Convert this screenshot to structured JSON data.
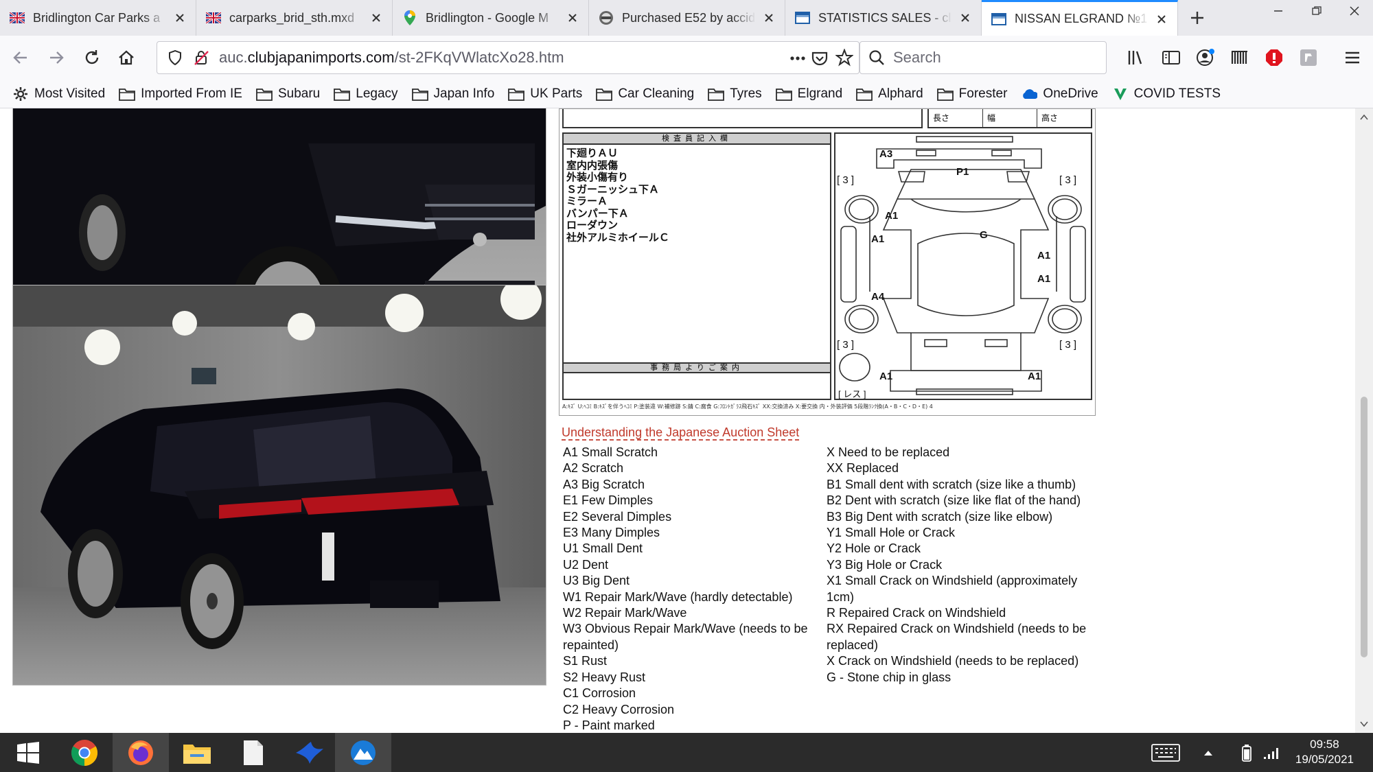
{
  "tabs": [
    {
      "title": "Bridlington Car Parks a",
      "icon": "union-jack-icon",
      "active": false
    },
    {
      "title": "carparks_brid_sth.mxd",
      "icon": "union-jack-icon",
      "active": false
    },
    {
      "title": "Bridlington - Google M",
      "icon": "maps-pin-icon",
      "active": false
    },
    {
      "title": "Purchased E52 by accid",
      "icon": "forum-icon",
      "active": false
    },
    {
      "title": "STATISTICS SALES - clu",
      "icon": "site-blue-icon",
      "active": false
    },
    {
      "title": "NISSAN ELGRAND №1",
      "icon": "site-blue-icon",
      "active": true
    }
  ],
  "address_bar": {
    "prefix": "auc.",
    "domain": "clubjapanimports.com",
    "path": "/st-2FKqVWlatcXo28.htm"
  },
  "search": {
    "placeholder": "Search"
  },
  "bookmarks": [
    {
      "label": "Most Visited",
      "icon": "gear-icon"
    },
    {
      "label": "Imported From IE",
      "icon": "folder-icon"
    },
    {
      "label": "Subaru",
      "icon": "folder-icon"
    },
    {
      "label": "Legacy",
      "icon": "folder-icon"
    },
    {
      "label": "Japan Info",
      "icon": "folder-icon"
    },
    {
      "label": "UK Parts",
      "icon": "folder-icon"
    },
    {
      "label": "Car Cleaning",
      "icon": "folder-icon"
    },
    {
      "label": "Tyres",
      "icon": "folder-icon"
    },
    {
      "label": "Elgrand",
      "icon": "folder-icon"
    },
    {
      "label": "Alphard",
      "icon": "folder-icon"
    },
    {
      "label": "Forester",
      "icon": "folder-icon"
    },
    {
      "label": "OneDrive",
      "icon": "cloud-icon"
    },
    {
      "label": "COVID TESTS",
      "icon": "v-icon"
    }
  ],
  "sheet": {
    "dims": [
      "長さ",
      "幅",
      "高さ"
    ],
    "inspector_header": "検査員記入欄",
    "inspector_notes": [
      "下廻りＡＵ",
      "室内内張傷",
      "外装小傷有り",
      "Ｓガーニッシュ下Ａ",
      "ミラーＡ",
      "バンパー下Ａ",
      "ローダウン",
      "社外アルミホイールＣ"
    ],
    "office_header": "事務局よりご案内",
    "footer": "A:ｷｽﾞ U:ﾍｺﾐ B:ｷｽﾞを伴うﾍｺﾐ P:塗装違 W:補修跡 S:錆 C:腐食 G:ﾌﾛﾝﾄｶﾞﾗｽ飛石ｷｽﾞ XX:交換済み X:要交換 内・外装評価 5段階ﾗﾝｸ換(A・B・C・D・E) 4",
    "diagram_labels": {
      "a3": "A3",
      "p1": "P1",
      "g": "G",
      "a1_fl": "A1",
      "a1_ml": "A1",
      "a1_mr": "A1",
      "a1_rr": "A1",
      "a4": "A4",
      "a1_bl": "A1",
      "a1_br": "A1",
      "n_tl": "[ 3 ]",
      "n_tr": "[ 3 ]",
      "n_bl": "[ 3 ]",
      "n_br": "[ 3 ]",
      "spare": "[ レス ]"
    }
  },
  "legend": {
    "title": "Understanding the Japanese Auction Sheet",
    "left": [
      "A1 Small Scratch",
      "A2 Scratch",
      "A3 Big Scratch",
      "E1 Few Dimples",
      "E2 Several Dimples",
      "E3 Many Dimples",
      "U1 Small Dent",
      "U2 Dent",
      "U3 Big Dent",
      "W1 Repair Mark/Wave (hardly detectable)",
      "W2 Repair Mark/Wave",
      "W3 Obvious Repair Mark/Wave (needs to be repainted)",
      "S1 Rust",
      "S2 Heavy Rust",
      "C1 Corrosion",
      "C2 Heavy Corrosion",
      "P - Paint marked"
    ],
    "right": [
      "X Need to be replaced",
      "XX Replaced",
      "B1 Small dent with scratch (size like a thumb)",
      "B2 Dent with scratch (size like flat of the hand)",
      "B3 Big Dent with scratch (size like elbow)",
      "Y1 Small Hole or Crack",
      "Y2 Hole or Crack",
      "Y3 Big Hole or Crack",
      "X1 Small Crack on Windshield (approximately 1cm)",
      "R Repaired Crack on Windshield",
      "RX Repaired Crack on Windshield (needs to be replaced)",
      "X Crack on Windshield (needs to be replaced)",
      "G - Stone chip in glass"
    ]
  },
  "taskbar": {
    "apps": [
      "start-icon",
      "chrome-icon",
      "firefox-icon",
      "file-explorer-icon",
      "blank-file-icon",
      "bird-app-icon",
      "mountain-app-icon"
    ],
    "time": "09:58",
    "date": "19/05/2021"
  },
  "colors": {
    "accent_tab": "#1f8bff",
    "legend_title": "#c0392b",
    "taskbar": "#2b2b2b"
  }
}
